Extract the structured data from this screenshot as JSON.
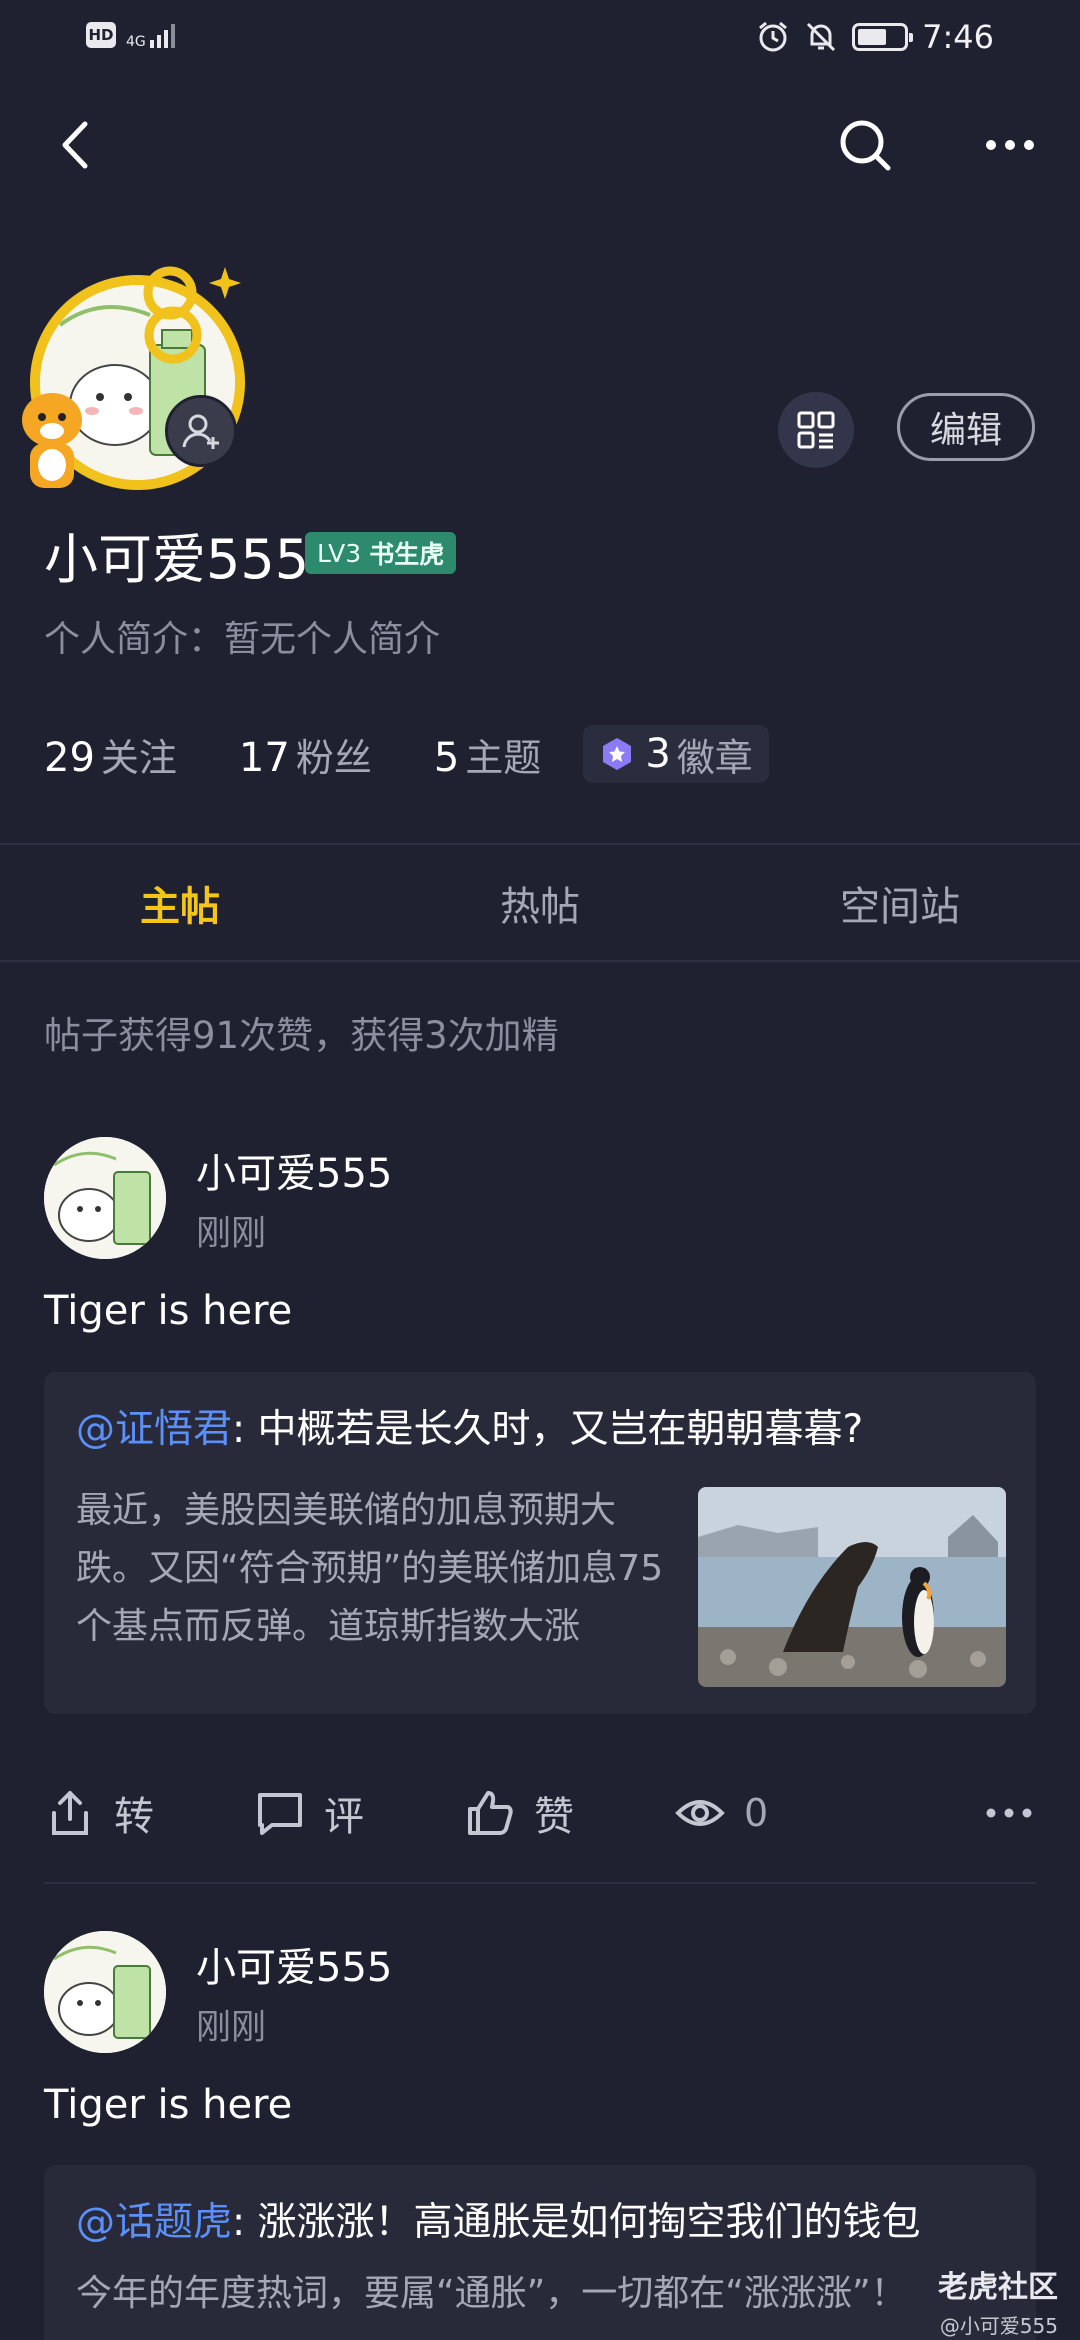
{
  "status_bar": {
    "hd": "HD",
    "network": "4G",
    "time": "7:46"
  },
  "profile": {
    "username": "小可爱555",
    "level": "LV3",
    "level_title": "书生虎",
    "bio": "个人简介：暂无个人简介",
    "edit_label": "编辑",
    "stats": [
      {
        "num": "29",
        "label": "关注"
      },
      {
        "num": "17",
        "label": "粉丝"
      },
      {
        "num": "5",
        "label": "主题"
      }
    ],
    "badges": {
      "num": "3",
      "label": "徽章"
    }
  },
  "tabs": [
    {
      "label": "主帖",
      "active": true
    },
    {
      "label": "热帖",
      "active": false
    },
    {
      "label": "空间站",
      "active": false
    }
  ],
  "summary": "帖子获得91次赞，获得3次加精",
  "posts": [
    {
      "author": "小可爱555",
      "time": "刚刚",
      "text": "Tiger is here",
      "quote": {
        "mention": "@证悟君",
        "title": ": 中概若是长久时，又岂在朝朝暮暮?",
        "body": "最近，美股因美联储的加息预期大跌。又因“符合预期”的美联储加息75个基点而反弹。道琼斯指数大涨"
      },
      "actions": {
        "share": "转",
        "comment": "评",
        "like": "赞",
        "views": "0"
      }
    },
    {
      "author": "小可爱555",
      "time": "刚刚",
      "text": "Tiger is here",
      "quote": {
        "mention": "@话题虎",
        "title": ": 涨涨涨！高通胀是如何掏空我们的钱包",
        "body": "今年的年度热词，要属“通胀”，一切都在“涨涨涨”！"
      }
    }
  ],
  "watermark": {
    "main": "老虎社区",
    "sub": "@小可爱555"
  }
}
